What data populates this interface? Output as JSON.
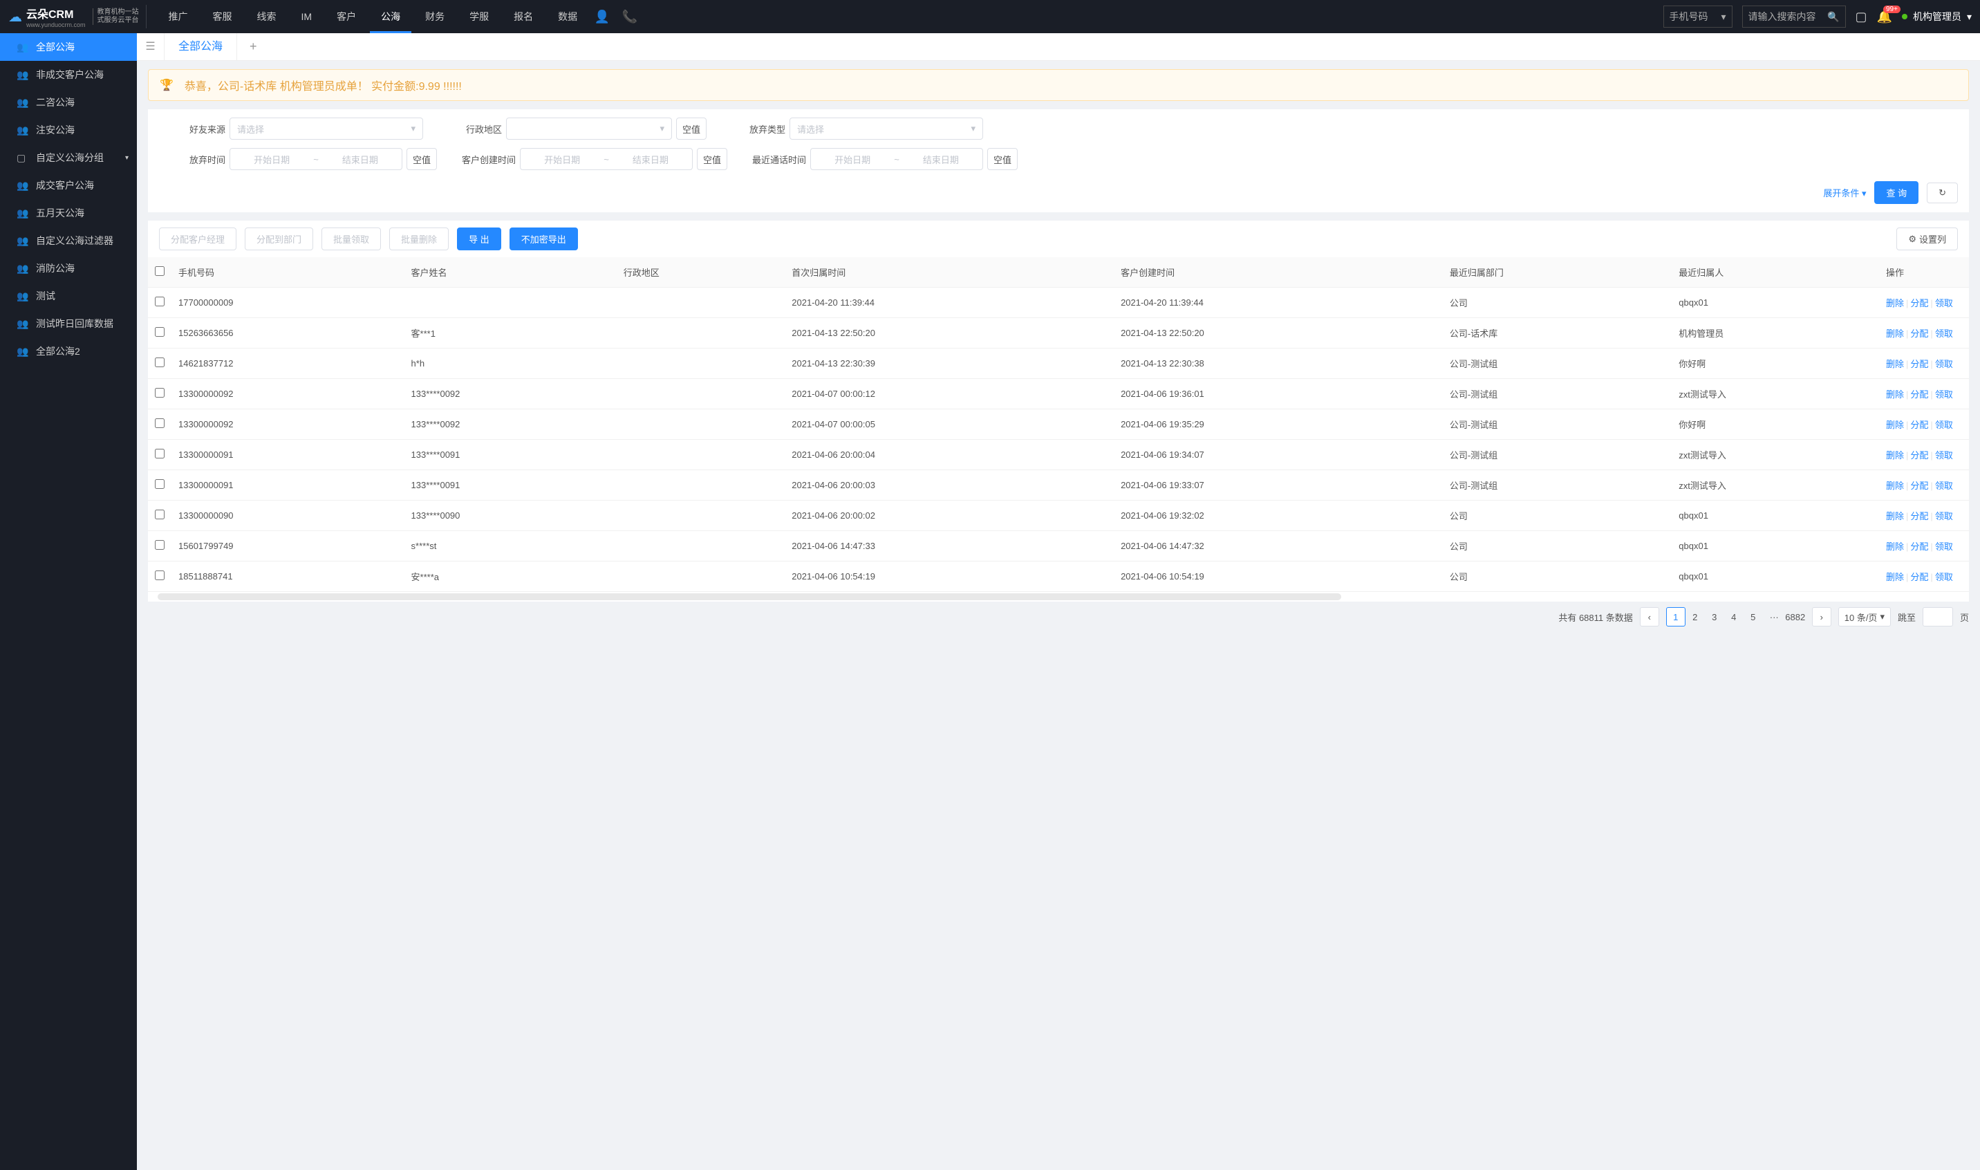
{
  "header": {
    "logo_main": "云朵CRM",
    "logo_url": "www.yunduocrm.com",
    "logo_sub1": "教育机构一站",
    "logo_sub2": "式服务云平台",
    "nav": [
      "推广",
      "客服",
      "线索",
      "IM",
      "客户",
      "公海",
      "财务",
      "学服",
      "报名",
      "数据"
    ],
    "nav_active_index": 5,
    "search_type": "手机号码",
    "search_placeholder": "请输入搜索内容",
    "badge": "99+",
    "user": "机构管理员"
  },
  "sidebar": {
    "items": [
      {
        "label": "全部公海",
        "icon": "👥",
        "active": true
      },
      {
        "label": "非成交客户公海",
        "icon": "👥"
      },
      {
        "label": "二咨公海",
        "icon": "👥"
      },
      {
        "label": "注安公海",
        "icon": "👥"
      },
      {
        "label": "自定义公海分组",
        "icon": "▢",
        "expandable": true
      },
      {
        "label": "成交客户公海",
        "icon": "👥"
      },
      {
        "label": "五月天公海",
        "icon": "👥"
      },
      {
        "label": "自定义公海过滤器",
        "icon": "👥"
      },
      {
        "label": "消防公海",
        "icon": "👥"
      },
      {
        "label": "测试",
        "icon": "👥"
      },
      {
        "label": "测试昨日回库数据",
        "icon": "👥"
      },
      {
        "label": "全部公海2",
        "icon": "👥"
      }
    ]
  },
  "tabs": {
    "current": "全部公海"
  },
  "banner": "恭喜，公司-话术库  机构管理员成单！  实付金额:9.99 !!!!!!",
  "filters": {
    "labels": {
      "friend_source": "好友来源",
      "region": "行政地区",
      "abandon_type": "放弃类型",
      "abandon_time": "放弃时间",
      "create_time": "客户创建时间",
      "last_call": "最近通话时间"
    },
    "placeholders": {
      "select": "请选择",
      "start": "开始日期",
      "end": "结束日期",
      "blank": "空值"
    },
    "expand": "展开条件",
    "search": "查 询"
  },
  "toolbar": {
    "assign_manager": "分配客户经理",
    "assign_dept": "分配到部门",
    "batch_claim": "批量领取",
    "batch_delete": "批量删除",
    "export": "导 出",
    "export_plain": "不加密导出",
    "columns": "设置列"
  },
  "table": {
    "headers": [
      "手机号码",
      "客户姓名",
      "行政地区",
      "首次归属时间",
      "客户创建时间",
      "最近归属部门",
      "最近归属人",
      "操作"
    ],
    "ops": {
      "delete": "删除",
      "assign": "分配",
      "claim": "领取"
    },
    "rows": [
      {
        "phone": "17700000009",
        "name": "",
        "region": "",
        "first": "2021-04-20 11:39:44",
        "created": "2021-04-20 11:39:44",
        "dept": "公司",
        "owner": "qbqx01"
      },
      {
        "phone": "15263663656",
        "name": "客***1",
        "region": "",
        "first": "2021-04-13 22:50:20",
        "created": "2021-04-13 22:50:20",
        "dept": "公司-话术库",
        "owner": "机构管理员"
      },
      {
        "phone": "14621837712",
        "name": "h*h",
        "region": "",
        "first": "2021-04-13 22:30:39",
        "created": "2021-04-13 22:30:38",
        "dept": "公司-测试组",
        "owner": "你好啊"
      },
      {
        "phone": "13300000092",
        "name": "133****0092",
        "region": "",
        "first": "2021-04-07 00:00:12",
        "created": "2021-04-06 19:36:01",
        "dept": "公司-测试组",
        "owner": "zxt测试导入"
      },
      {
        "phone": "13300000092",
        "name": "133****0092",
        "region": "",
        "first": "2021-04-07 00:00:05",
        "created": "2021-04-06 19:35:29",
        "dept": "公司-测试组",
        "owner": "你好啊"
      },
      {
        "phone": "13300000091",
        "name": "133****0091",
        "region": "",
        "first": "2021-04-06 20:00:04",
        "created": "2021-04-06 19:34:07",
        "dept": "公司-测试组",
        "owner": "zxt测试导入"
      },
      {
        "phone": "13300000091",
        "name": "133****0091",
        "region": "",
        "first": "2021-04-06 20:00:03",
        "created": "2021-04-06 19:33:07",
        "dept": "公司-测试组",
        "owner": "zxt测试导入"
      },
      {
        "phone": "13300000090",
        "name": "133****0090",
        "region": "",
        "first": "2021-04-06 20:00:02",
        "created": "2021-04-06 19:32:02",
        "dept": "公司",
        "owner": "qbqx01"
      },
      {
        "phone": "15601799749",
        "name": "s****st",
        "region": "",
        "first": "2021-04-06 14:47:33",
        "created": "2021-04-06 14:47:32",
        "dept": "公司",
        "owner": "qbqx01"
      },
      {
        "phone": "18511888741",
        "name": "安****a",
        "region": "",
        "first": "2021-04-06 10:54:19",
        "created": "2021-04-06 10:54:19",
        "dept": "公司",
        "owner": "qbqx01"
      }
    ]
  },
  "pager": {
    "total_text": "共有 68811 条数据",
    "pages": [
      "1",
      "2",
      "3",
      "4",
      "5"
    ],
    "last": "6882",
    "per_page": "10 条/页",
    "jump": "跳至",
    "page_suffix": "页"
  }
}
